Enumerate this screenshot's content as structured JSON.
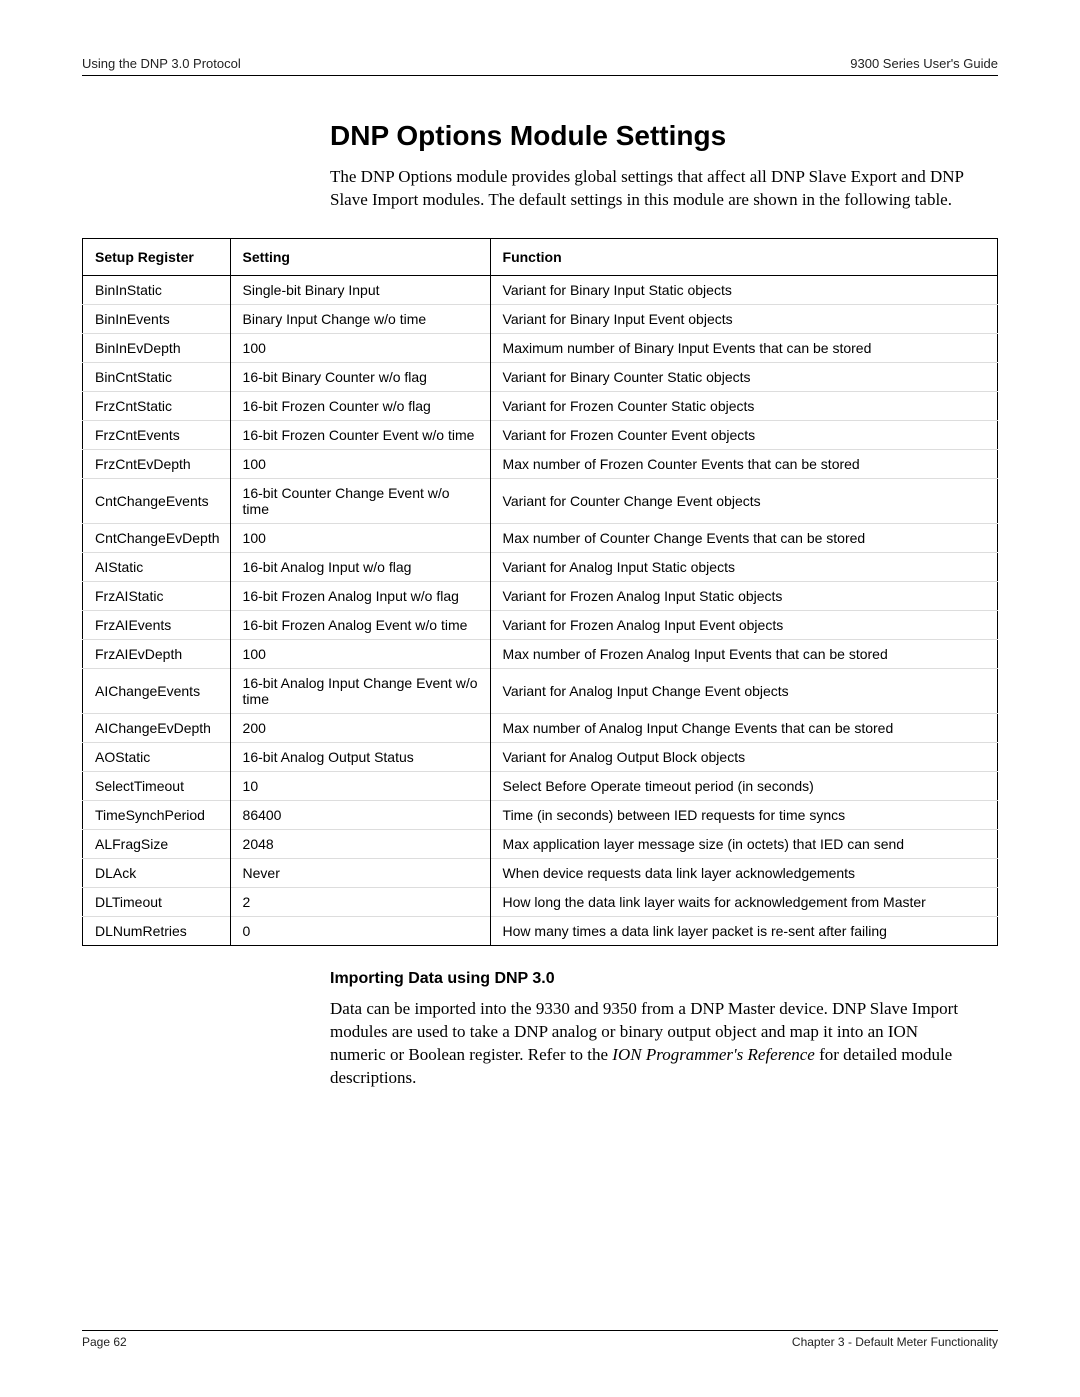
{
  "header": {
    "left": "Using the DNP 3.0 Protocol",
    "right": "9300 Series User's Guide"
  },
  "section_title": "DNP Options Module Settings",
  "intro": "The DNP Options module provides global settings that affect all DNP Slave Export and DNP Slave Import modules. The default settings in this module are shown in the following table.",
  "table": {
    "headers": {
      "c1": "Setup Register",
      "c2": "Setting",
      "c3": "Function"
    },
    "rows": [
      {
        "c1": "BinInStatic",
        "c2": "Single-bit Binary Input",
        "c3": "Variant for Binary Input Static objects"
      },
      {
        "c1": "BinInEvents",
        "c2": "Binary Input Change w/o time",
        "c3": "Variant for Binary Input Event objects"
      },
      {
        "c1": "BinInEvDepth",
        "c2": "100",
        "c3": "Maximum number of Binary Input Events that can be stored"
      },
      {
        "c1": "BinCntStatic",
        "c2": "16-bit Binary Counter w/o flag",
        "c3": "Variant for Binary Counter Static objects"
      },
      {
        "c1": "FrzCntStatic",
        "c2": "16-bit Frozen Counter w/o flag",
        "c3": "Variant for Frozen Counter Static objects"
      },
      {
        "c1": "FrzCntEvents",
        "c2": "16-bit Frozen Counter Event w/o time",
        "c3": "Variant for Frozen Counter Event objects"
      },
      {
        "c1": "FrzCntEvDepth",
        "c2": "100",
        "c3": "Max number of Frozen Counter Events that can be stored"
      },
      {
        "c1": "CntChangeEvents",
        "c2": "16-bit Counter Change Event w/o time",
        "c3": "Variant for Counter Change Event objects"
      },
      {
        "c1": "CntChangeEvDepth",
        "c2": "100",
        "c3": "Max number of Counter Change Events that can be stored"
      },
      {
        "c1": "AIStatic",
        "c2": "16-bit Analog Input w/o flag",
        "c3": "Variant for Analog Input Static objects"
      },
      {
        "c1": "FrzAIStatic",
        "c2": "16-bit Frozen Analog Input w/o flag",
        "c3": "Variant for Frozen Analog Input Static objects"
      },
      {
        "c1": "FrzAIEvents",
        "c2": "16-bit Frozen Analog Event w/o time",
        "c3": "Variant for Frozen Analog Input Event objects"
      },
      {
        "c1": "FrzAIEvDepth",
        "c2": "100",
        "c3": "Max number of Frozen Analog Input Events that can be stored"
      },
      {
        "c1": "AIChangeEvents",
        "c2": "16-bit Analog Input Change Event w/o time",
        "c3": "Variant for Analog Input Change Event objects"
      },
      {
        "c1": "AIChangeEvDepth",
        "c2": "200",
        "c3": "Max number of Analog Input Change Events that can be stored"
      },
      {
        "c1": "AOStatic",
        "c2": "16-bit Analog Output Status",
        "c3": "Variant for Analog Output Block objects"
      },
      {
        "c1": "SelectTimeout",
        "c2": "10",
        "c3": "Select Before Operate timeout period (in seconds)"
      },
      {
        "c1": "TimeSynchPeriod",
        "c2": "86400",
        "c3": "Time (in seconds) between IED requests for time syncs"
      },
      {
        "c1": "ALFragSize",
        "c2": "2048",
        "c3": "Max application layer message size (in octets) that IED can send"
      },
      {
        "c1": "DLAck",
        "c2": "Never",
        "c3": "When device requests data link layer acknowledgements"
      },
      {
        "c1": "DLTimeout",
        "c2": "2",
        "c3": "How long the data link layer waits for acknowledgement from Master"
      },
      {
        "c1": "DLNumRetries",
        "c2": "0",
        "c3": "How many times a data link layer packet is re-sent after failing"
      }
    ]
  },
  "sub_heading": "Importing Data using DNP 3.0",
  "body_para_pre": "Data can be imported into the 9330 and 9350 from a DNP Master device. DNP Slave Import modules are used to take a DNP analog or binary output object and map it into an ION numeric or Boolean register. Refer to the ",
  "body_para_ital": "ION Programmer's Reference",
  "body_para_post": " for detailed module descriptions.",
  "footer": {
    "left": "Page 62",
    "right": "Chapter 3 - Default Meter Functionality"
  }
}
